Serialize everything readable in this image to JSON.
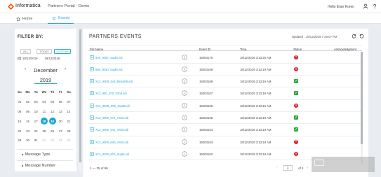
{
  "header": {
    "brand": "Informatica",
    "portal_title": "Partners Portal - Demo",
    "greeting": "Hello Eran Koren",
    "icons": [
      "informatica-logo",
      "user-icon",
      "help-icon"
    ]
  },
  "nav": {
    "tabs": [
      {
        "label": "Home",
        "icon": "home-icon",
        "active": false
      },
      {
        "label": "Events",
        "icon": "bell-icon",
        "active": true
      }
    ]
  },
  "filter": {
    "title": "FILTER BY:",
    "segments": [
      "ALL",
      "TODAY",
      "CUSTOM"
    ],
    "active_segment": "CUSTOM",
    "date_range": {
      "from": "18/12/2019",
      "to": "19/12/2019"
    },
    "calendar": {
      "prev": "‹",
      "next": "›",
      "month": "December",
      "year": "2019",
      "weekdays": [
        "Su",
        "Mo",
        "Tu",
        "We",
        "Th",
        "Fr",
        "Sa"
      ],
      "weeks": [
        [
          "01",
          "02",
          "03",
          "04",
          "05",
          "06",
          "07"
        ],
        [
          "08",
          "09",
          "10",
          "11",
          "12",
          "13",
          "14"
        ],
        [
          "15",
          "16",
          "17",
          "18",
          "19",
          "20",
          "21"
        ],
        [
          "22",
          "23",
          "24",
          "25",
          "26",
          "27",
          "28"
        ],
        [
          "29",
          "30",
          "31",
          "01",
          "02",
          "03",
          "04"
        ]
      ],
      "selected": [
        "18",
        "19"
      ]
    },
    "sections": [
      "Message Type",
      "Message Number"
    ]
  },
  "events": {
    "title": "PARTNERS EVENTS",
    "updated": "Updated : 18/12/2019 7:26:07 PM",
    "columns": [
      "File Name",
      "",
      "Event ID",
      "Time",
      "Status",
      "Acknowledgment"
    ],
    "rows": [
      {
        "file": "849_9000_Supl8.edi",
        "event_id": "15003170",
        "time": "18/12/2019 3:13:20 AM",
        "status": "error"
      },
      {
        "file": "856_9030_Supl8.edi",
        "event_id": "15003169",
        "time": "18/12/2019 3:13:19 AM",
        "status": "error"
      },
      {
        "file": "X12_9008_Sell_Blond08.edi",
        "event_id": "15003168",
        "time": "18/12/2019 3:13:19 AM",
        "status": "ok"
      },
      {
        "file": "X12_850_970_Vshd.edi",
        "event_id": "15003167",
        "time": "18/12/2019 3:13:19 AM",
        "status": "ok"
      },
      {
        "file": "X12_850B_800_Supl8.edi",
        "event_id": "15003166",
        "time": "18/12/2019 3:13:19 AM",
        "status": "error"
      },
      {
        "file": "X12_9000_974_Vshd.edi",
        "event_id": "15003165",
        "time": "18/12/2019 3:13:19 AM",
        "status": "ok"
      },
      {
        "file": "X12_9000_941_Vshd.edi",
        "event_id": "15003164",
        "time": "18/12/2019 3:13:19 AM",
        "status": "ok"
      },
      {
        "file": "X12_9000_940_Vshd.edi",
        "event_id": "15003163",
        "time": "18/12/2019 3:13:18 AM",
        "status": "error"
      },
      {
        "file": "X12_9030_810_Supl8.edi",
        "event_id": "15003162",
        "time": "18/12/2019 3:13:18 AM",
        "status": "error"
      }
    ],
    "range": "1 — 25 of 86",
    "page": "1",
    "page_of": "of 4",
    "prev_page": "‹",
    "next_page": "›"
  },
  "colors": {
    "accent": "#2aa9d6",
    "error": "#d9232e",
    "ok": "#2eaa3f",
    "background": "#e9edf1"
  }
}
